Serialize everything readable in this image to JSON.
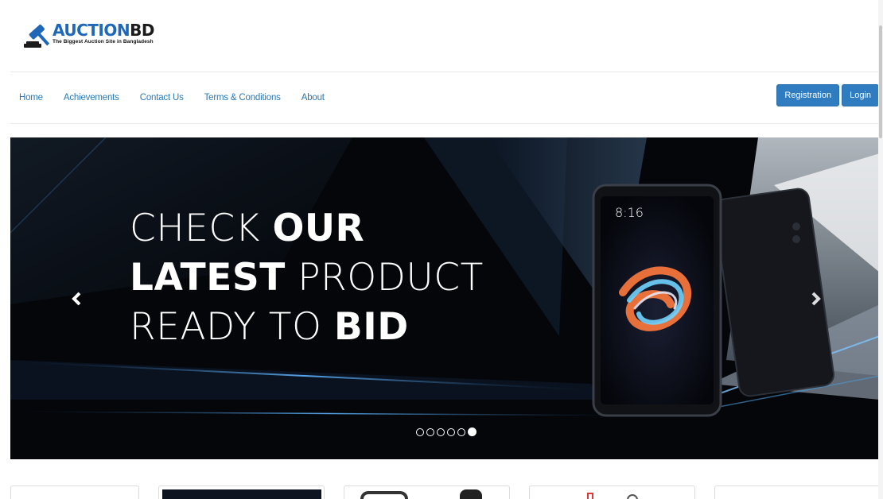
{
  "brand": {
    "name_part1": "AUCTION",
    "name_part2": "BD",
    "tagline": "The Biggest Auction Site in Bangladesh",
    "colors": {
      "primary": "#1f67b8",
      "dark": "#1b1b1b"
    }
  },
  "nav": {
    "items": [
      {
        "label": "Home"
      },
      {
        "label": "Achievements"
      },
      {
        "label": "Contact Us"
      },
      {
        "label": "Terms & Conditions"
      },
      {
        "label": "About"
      }
    ],
    "color": "#2a79b5"
  },
  "auth": {
    "registration_label": "Registration",
    "login_label": "Login",
    "button_color": "#2f7cc1"
  },
  "carousel": {
    "line1_light": "CHECK ",
    "line1_bold": "OUR",
    "line2_bold": "LATEST",
    "line2_light": " PRODUCT",
    "line3_light": "READY TO ",
    "line3_bold": "BID",
    "phone_time": "8:16",
    "slide_count": 6,
    "active_slide": 6,
    "prev_icon": "chevron-left-icon",
    "next_icon": "chevron-right-icon"
  }
}
